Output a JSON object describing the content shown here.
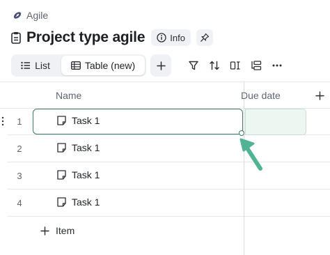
{
  "breadcrumb": {
    "label": "Agile",
    "icon": "football-icon"
  },
  "header": {
    "title": "Project type agile",
    "title_icon": "clipboard-icon",
    "info_label": "Info",
    "pin_icon": "pin-icon"
  },
  "views": {
    "list_label": "List",
    "table_label": "Table (new)",
    "active": "Table (new)"
  },
  "toolbar": [
    "filter-icon",
    "sort-icon",
    "columns-icon",
    "group-icon",
    "more-icon"
  ],
  "table": {
    "columns": [
      "Name",
      "Due date"
    ],
    "rows": [
      {
        "num": "1",
        "name": "Task 1"
      },
      {
        "num": "2",
        "name": "Task 1"
      },
      {
        "num": "3",
        "name": "Task 1"
      },
      {
        "num": "4",
        "name": "Task 1"
      }
    ],
    "add_item_label": "Item"
  },
  "colors": {
    "selection": "#3f7a63",
    "arrow": "#4fb394"
  }
}
